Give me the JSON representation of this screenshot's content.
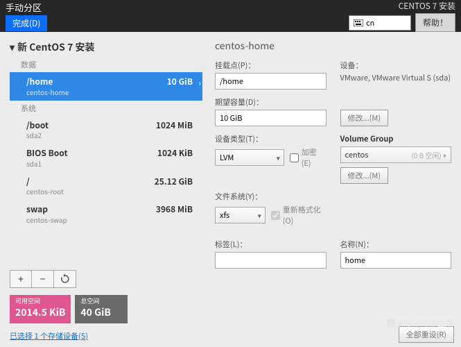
{
  "header": {
    "title": "手动分区",
    "done": "完成(D)",
    "install_label": "CENTOS 7 安装",
    "lang_code": "cn",
    "help": "帮助！"
  },
  "left": {
    "tree_title": "新 CentOS 7 安装",
    "group_data": "数据",
    "group_system": "系统",
    "partitions": [
      {
        "name": "/home",
        "sub": "centos-home",
        "size": "10 GiB",
        "selected": true,
        "group": "data"
      },
      {
        "name": "/boot",
        "sub": "sda2",
        "size": "1024 MiB",
        "group": "system"
      },
      {
        "name": "BIOS Boot",
        "sub": "sda1",
        "size": "1024 KiB",
        "group": "system"
      },
      {
        "name": "/",
        "sub": "centos-root",
        "size": "25.12 GiB",
        "group": "system"
      },
      {
        "name": "swap",
        "sub": "centos-swap",
        "size": "3968 MiB",
        "group": "system"
      }
    ],
    "space_avail_label": "可用空间",
    "space_avail_value": "2014.5 KiB",
    "space_total_label": "总空间",
    "space_total_value": "40 GiB",
    "storage_link": "已选择 1 个存储设备(S)"
  },
  "right": {
    "heading": "centos-home",
    "mountpoint_label": "挂载点(P)：",
    "mountpoint_value": "/home",
    "device_label": "设备：",
    "device_text": "VMware, VMware Virtual S (sda)",
    "modify_btn": "修改...(M)",
    "desired_label": "期望容量(D)：",
    "desired_value": "10 GiB",
    "device_type_label": "设备类型(T)：",
    "device_type_value": "LVM",
    "encrypt_label": "加密(E)",
    "volume_group_label": "Volume Group",
    "vg_name": "centos",
    "vg_free": "(0 B 空闲)",
    "filesystem_label": "文件系统(Y)：",
    "filesystem_value": "xfs",
    "reformat_label": "重新格式化(O)",
    "labelfield_label": "标签(L)：",
    "labelfield_value": "",
    "name_label": "名称(N)：",
    "name_value": "home",
    "reset_btn": "全部重设(R)"
  },
  "watermark": "知乎 @中华坚果"
}
